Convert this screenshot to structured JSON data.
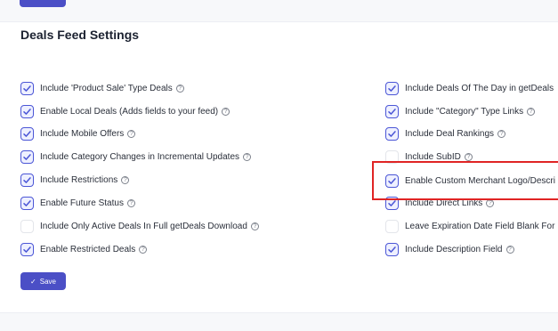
{
  "section": {
    "title": "Deals Feed Settings"
  },
  "help_glyph": "?",
  "left": [
    {
      "label": "Include 'Product Sale' Type Deals",
      "checked": true
    },
    {
      "label": "Enable Local Deals (Adds fields to your feed)",
      "checked": true
    },
    {
      "label": "Include Mobile Offers",
      "checked": true
    },
    {
      "label": "Include Category Changes in Incremental Updates",
      "checked": true
    },
    {
      "label": "Include Restrictions",
      "checked": true
    },
    {
      "label": "Enable Future Status",
      "checked": true
    },
    {
      "label": "Include Only Active Deals In Full getDeals Download",
      "checked": false
    },
    {
      "label": "Enable Restricted Deals",
      "checked": true
    }
  ],
  "right": [
    {
      "label": "Include Deals Of The Day in getDeals",
      "checked": true
    },
    {
      "label": "Include \"Category\" Type Links",
      "checked": true
    },
    {
      "label": "Include Deal Rankings",
      "checked": true
    },
    {
      "label": "Include SubID",
      "checked": false
    },
    {
      "label": "Enable Custom Merchant Logo/Descri",
      "checked": true
    },
    {
      "label": "Include Direct Links",
      "checked": true
    },
    {
      "label": "Leave Expiration Date Field Blank For",
      "checked": false
    },
    {
      "label": "Include Description Field",
      "checked": true
    }
  ],
  "save_button": {
    "label": "Save",
    "icon": "check-icon"
  },
  "colors": {
    "accent": "#4b4fc6",
    "highlight": "#e02424"
  }
}
